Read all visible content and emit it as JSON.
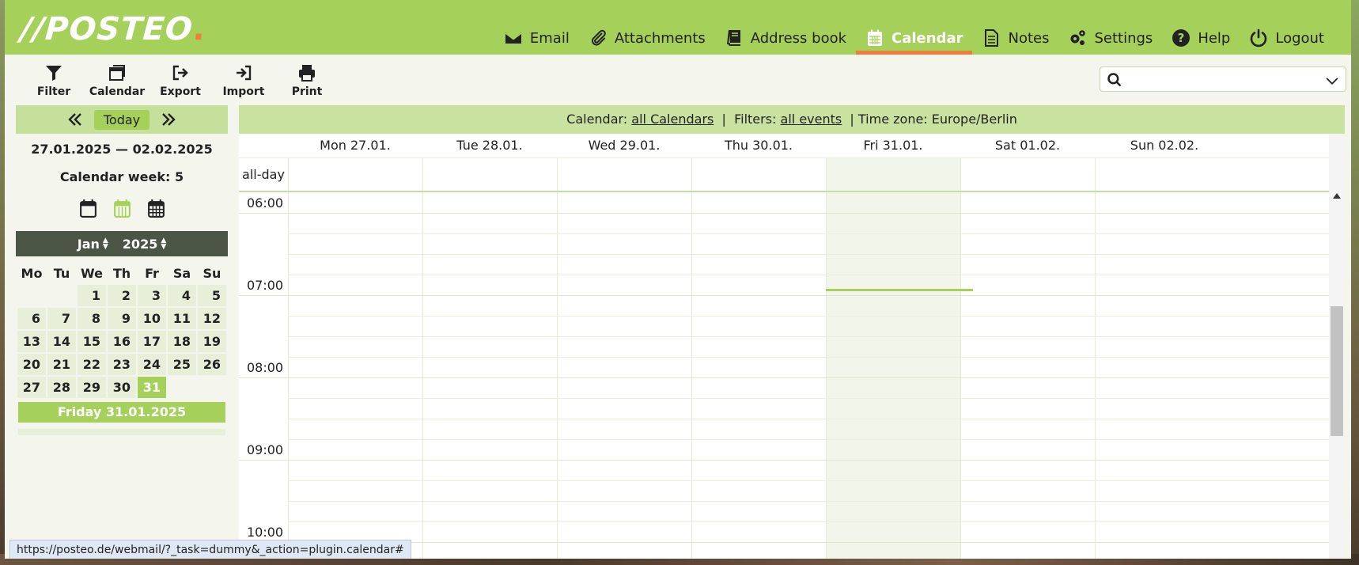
{
  "logo": {
    "text": "//POSTEO",
    "dot": "."
  },
  "nav": [
    {
      "label": "Email",
      "icon": "envelope-icon"
    },
    {
      "label": "Attachments",
      "icon": "paperclip-icon"
    },
    {
      "label": "Address book",
      "icon": "book-icon"
    },
    {
      "label": "Calendar",
      "icon": "calendar-icon",
      "active": true
    },
    {
      "label": "Notes",
      "icon": "note-icon"
    },
    {
      "label": "Settings",
      "icon": "gears-icon"
    },
    {
      "label": "Help",
      "icon": "help-icon"
    },
    {
      "label": "Logout",
      "icon": "power-icon"
    }
  ],
  "toolbar": {
    "filter": "Filter",
    "calendar": "Calendar",
    "export": "Export",
    "import": "Import",
    "print": "Print"
  },
  "search": {
    "placeholder": ""
  },
  "sidebar": {
    "today": "Today",
    "date_range": "27.01.2025 — 02.02.2025",
    "week": "Calendar week: 5",
    "month": "Jan",
    "year": "2025",
    "weekdays": [
      "Mo",
      "Tu",
      "We",
      "Th",
      "Fr",
      "Sa",
      "Su"
    ],
    "weeks": [
      [
        "",
        "",
        "1",
        "2",
        "3",
        "4",
        "5"
      ],
      [
        "6",
        "7",
        "8",
        "9",
        "10",
        "11",
        "12"
      ],
      [
        "13",
        "14",
        "15",
        "16",
        "17",
        "18",
        "19"
      ],
      [
        "20",
        "21",
        "22",
        "23",
        "24",
        "25",
        "26"
      ],
      [
        "27",
        "28",
        "29",
        "30",
        "31",
        "",
        ""
      ]
    ],
    "selected_day": "31",
    "selected_date": "Friday 31.01.2025"
  },
  "infobar": {
    "calendar_label": "Calendar:",
    "calendar_link": "all Calendars",
    "sep1": "|",
    "filters_label": "Filters:",
    "filters_link": "all events",
    "tz": "| Time zone: Europe/Berlin"
  },
  "week_view": {
    "days": [
      "Mon 27.01.",
      "Tue 28.01.",
      "Wed 29.01.",
      "Thu 30.01.",
      "Fri 31.01.",
      "Sat 01.02.",
      "Sun 02.02."
    ],
    "today_index": 4,
    "allday_label": "all-day",
    "hours": [
      "06:00",
      "07:00",
      "08:00",
      "09:00",
      "10:00"
    ]
  },
  "status_url": "https://posteo.de/webmail/?_task=dummy&_action=plugin.calendar#",
  "colors": {
    "brand_green": "#a5d15a",
    "accent_orange": "#f07d3a",
    "dark_bar": "#4a5546"
  }
}
